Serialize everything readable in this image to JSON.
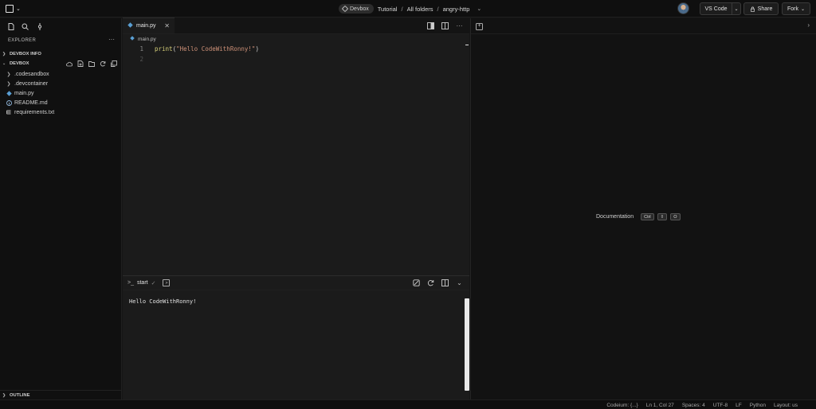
{
  "topbar": {
    "devbox_label": "Devbox",
    "breadcrumb": [
      "Tutorial",
      "All folders",
      "angry-http"
    ],
    "separator": "/",
    "editor_button": "VS Code",
    "share_button": "Share",
    "fork_button": "Fork"
  },
  "sidebar": {
    "explorer_title": "EXPLORER",
    "more": "···",
    "devbox_info_header": "DEVBOX INFO",
    "devbox_header": "DEVBOX",
    "files": [
      {
        "name": ".codesandbox",
        "type": "folder"
      },
      {
        "name": ".devcontainer",
        "type": "folder"
      },
      {
        "name": "main.py",
        "type": "python-file"
      },
      {
        "name": "README.md",
        "type": "info-file"
      },
      {
        "name": "requirements.txt",
        "type": "text-file"
      }
    ],
    "outline_header": "OUTLINE"
  },
  "editor": {
    "tab_label": "main.py",
    "breadcrumb_file": "main.py",
    "lines": [
      {
        "number": "1",
        "fn": "print",
        "open": "(",
        "str": "\"Hello CodeWithRonny!\"",
        "close": ")"
      },
      {
        "number": "2"
      }
    ]
  },
  "terminal": {
    "tab_label": "start",
    "output": "Hello CodeWithRonny!"
  },
  "right_panel": {
    "hint_label": "Documentation",
    "keys": [
      "Ctrl",
      "⇧",
      "O"
    ]
  },
  "statusbar": {
    "items": [
      "Codeium: {...}",
      "Ln 1, Col 27",
      "Spaces: 4",
      "UTF-8",
      "LF",
      "Python",
      "Layout: us"
    ]
  },
  "colors": {
    "background": "#151515",
    "editor_bg": "#1b1b1b",
    "python_icon": "#5a9fd4",
    "string": "#ce9178",
    "function": "#d8d27a"
  }
}
